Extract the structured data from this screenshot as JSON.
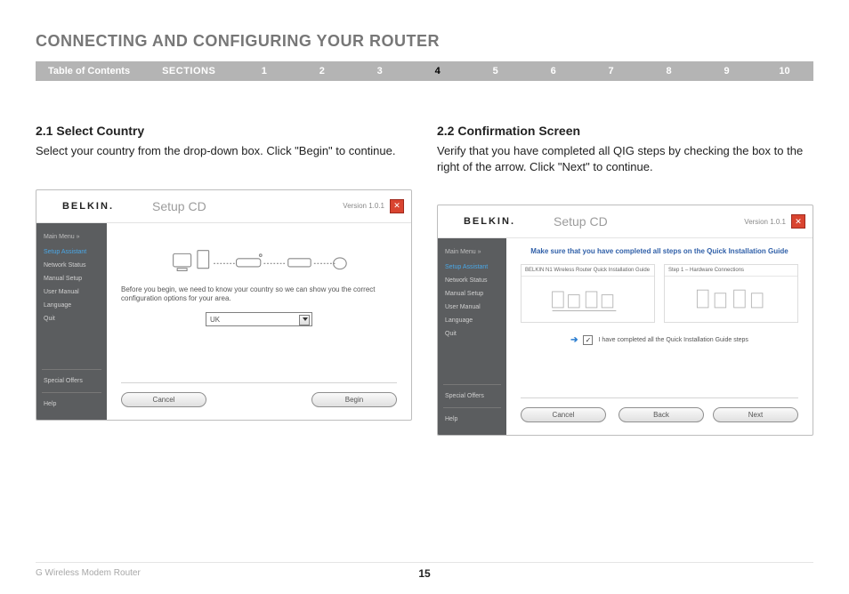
{
  "page": {
    "title": "CONNECTING AND CONFIGURING YOUR ROUTER",
    "footer": "G Wireless Modem Router",
    "page_number": "15"
  },
  "nav": {
    "toc_label": "Table of Contents",
    "sections_label": "SECTIONS",
    "items": [
      "1",
      "2",
      "3",
      "4",
      "5",
      "6",
      "7",
      "8",
      "9",
      "10"
    ],
    "active_index": 3
  },
  "left": {
    "heading": "2.1 Select Country",
    "body": "Select your country from the drop-down box. Click \"Begin\" to continue.",
    "shot": {
      "brand": "BELKIN",
      "chip_title": "Setup CD",
      "version": "Version 1.0.1",
      "sidebar": {
        "header": "Main Menu  »",
        "items": [
          "Setup Assistant",
          "Network Status",
          "Manual Setup",
          "User Manual",
          "Language",
          "Quit"
        ],
        "active_index": 0,
        "footer": [
          "Special Offers",
          "Help"
        ]
      },
      "message": "Before you begin, we need to know your country so we can show you the correct configuration options for your area.",
      "select_value": "UK",
      "buttons": {
        "cancel": "Cancel",
        "begin": "Begin"
      }
    }
  },
  "right": {
    "heading": "2.2 Confirmation Screen",
    "body": "Verify that you have completed all QIG steps by checking the box to the right of the arrow. Click \"Next\" to continue.",
    "shot": {
      "brand": "BELKIN",
      "chip_title": "Setup CD",
      "version": "Version 1.0.1",
      "sidebar": {
        "header": "Main Menu  »",
        "items": [
          "Setup Assistant",
          "Network Status",
          "Manual Setup",
          "User Manual",
          "Language",
          "Quit"
        ],
        "active_index": 0,
        "footer": [
          "Special Offers",
          "Help"
        ]
      },
      "banner": "Make sure that you have completed all steps on the Quick Installation Guide",
      "pane_left_title": "BELKIN   N1 Wireless Router   Quick Installation Guide",
      "pane_right_title": "Step 1 – Hardware Connections",
      "checkbox_label": "I have completed all the Quick Installation Guide steps",
      "buttons": {
        "cancel": "Cancel",
        "back": "Back",
        "next": "Next"
      }
    }
  }
}
